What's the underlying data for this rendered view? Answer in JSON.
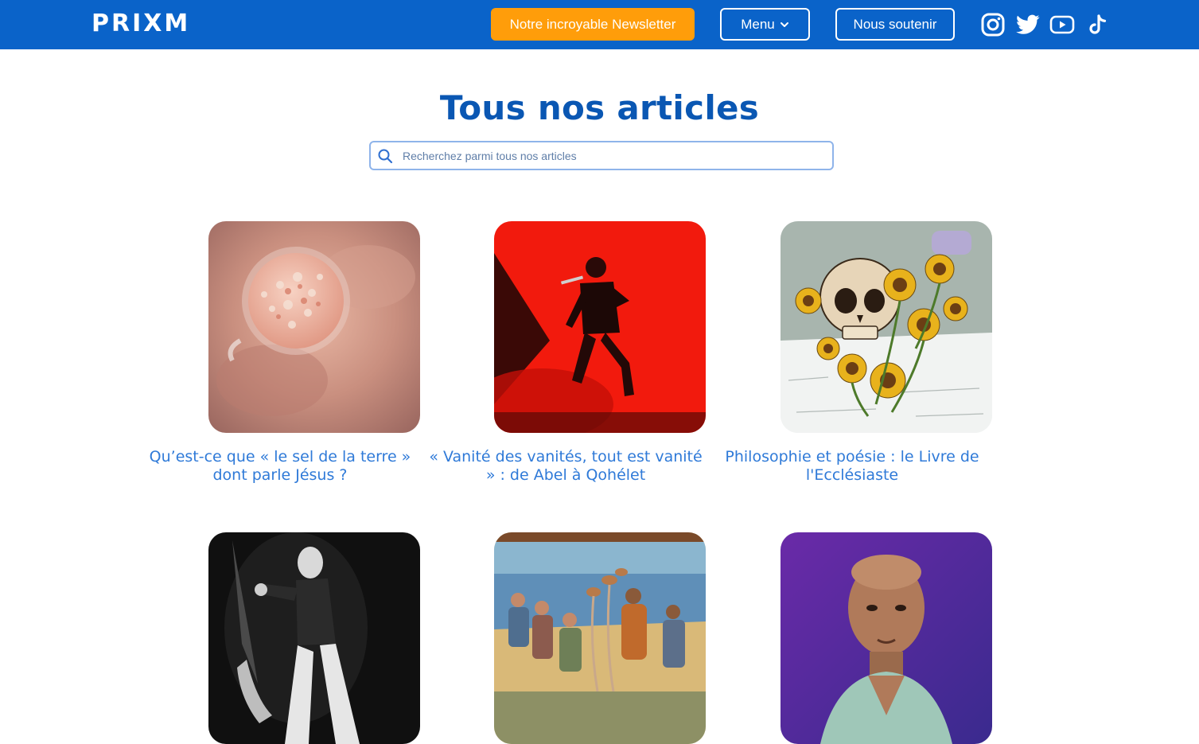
{
  "header": {
    "logo": "PRIXM",
    "newsletter_label": "Notre incroyable Newsletter",
    "menu_label": "Menu",
    "support_label": "Nous soutenir",
    "social": [
      "instagram-icon",
      "twitter-icon",
      "youtube-icon",
      "tiktok-icon"
    ]
  },
  "main": {
    "title": "Tous nos articles",
    "search_placeholder": "Recherchez parmi tous nos articles"
  },
  "articles": [
    {
      "title": "Qu’est-ce que « le sel de la terre » dont parle Jésus ?"
    },
    {
      "title": "« Vanité des vanités, tout est vanité » : de Abel à Qohélet"
    },
    {
      "title": "Philosophie et poésie : le Livre de l'Ecclésiaste"
    },
    {
      "title": ""
    },
    {
      "title": ""
    },
    {
      "title": ""
    }
  ],
  "colors": {
    "brand": "#0a63c9",
    "accent": "#ff9d0a",
    "link": "#2f7ad8"
  }
}
